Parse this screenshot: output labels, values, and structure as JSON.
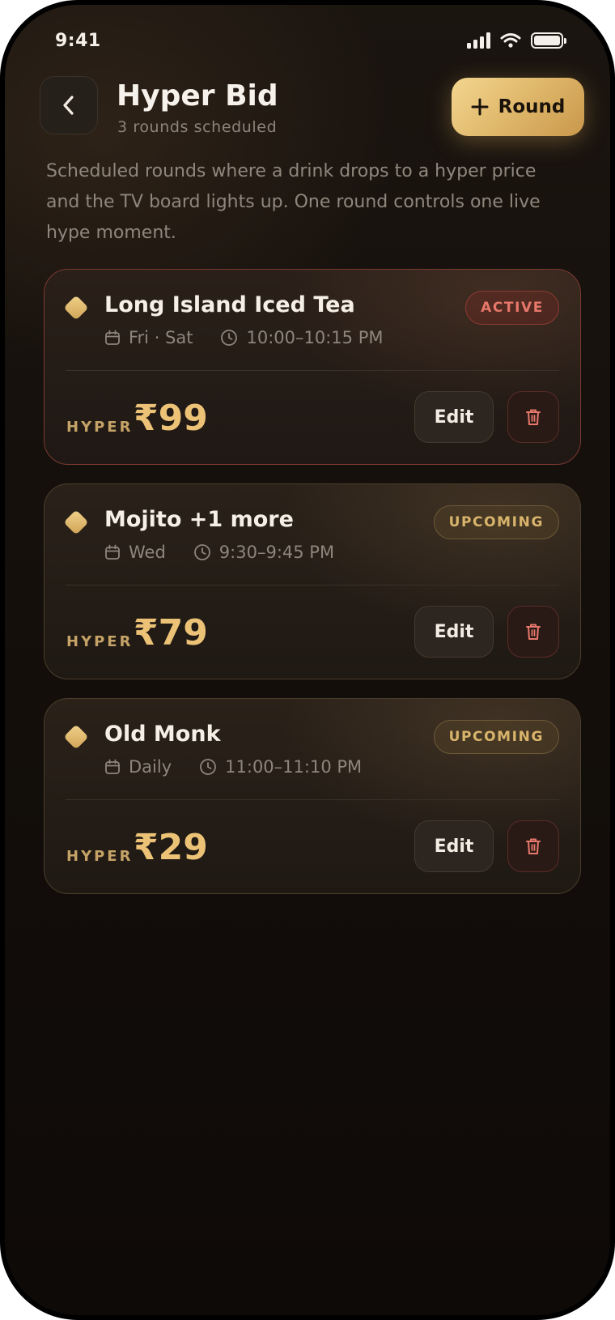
{
  "status_bar": {
    "time": "9:41"
  },
  "header": {
    "title": "Hyper Bid",
    "subtitle": "3 rounds scheduled",
    "add_label": "Round"
  },
  "description": "Scheduled rounds where a drink drops to a hyper price and the TV board lights up. One round controls one live hype moment.",
  "rounds": [
    {
      "name": "Long Island Iced Tea",
      "days": "Fri · Sat",
      "time": "10:00–10:15 PM",
      "status": "ACTIVE",
      "price_label": "HYPER",
      "price": "₹99",
      "edit_label": "Edit"
    },
    {
      "name": "Mojito +1 more",
      "days": "Wed",
      "time": "9:30–9:45 PM",
      "status": "UPCOMING",
      "price_label": "HYPER",
      "price": "₹79",
      "edit_label": "Edit"
    },
    {
      "name": "Old Monk",
      "days": "Daily",
      "time": "11:00–11:10 PM",
      "status": "UPCOMING",
      "price_label": "HYPER",
      "price": "₹29",
      "edit_label": "Edit"
    }
  ],
  "colors": {
    "accent": "#ddb467",
    "active": "#e7786b",
    "background": "#140f0b"
  },
  "icons": [
    "signal-icon",
    "wifi-icon",
    "battery-icon",
    "back-chevron-icon",
    "plus-icon",
    "diamond-icon",
    "calendar-icon",
    "clock-icon",
    "trash-icon"
  ]
}
